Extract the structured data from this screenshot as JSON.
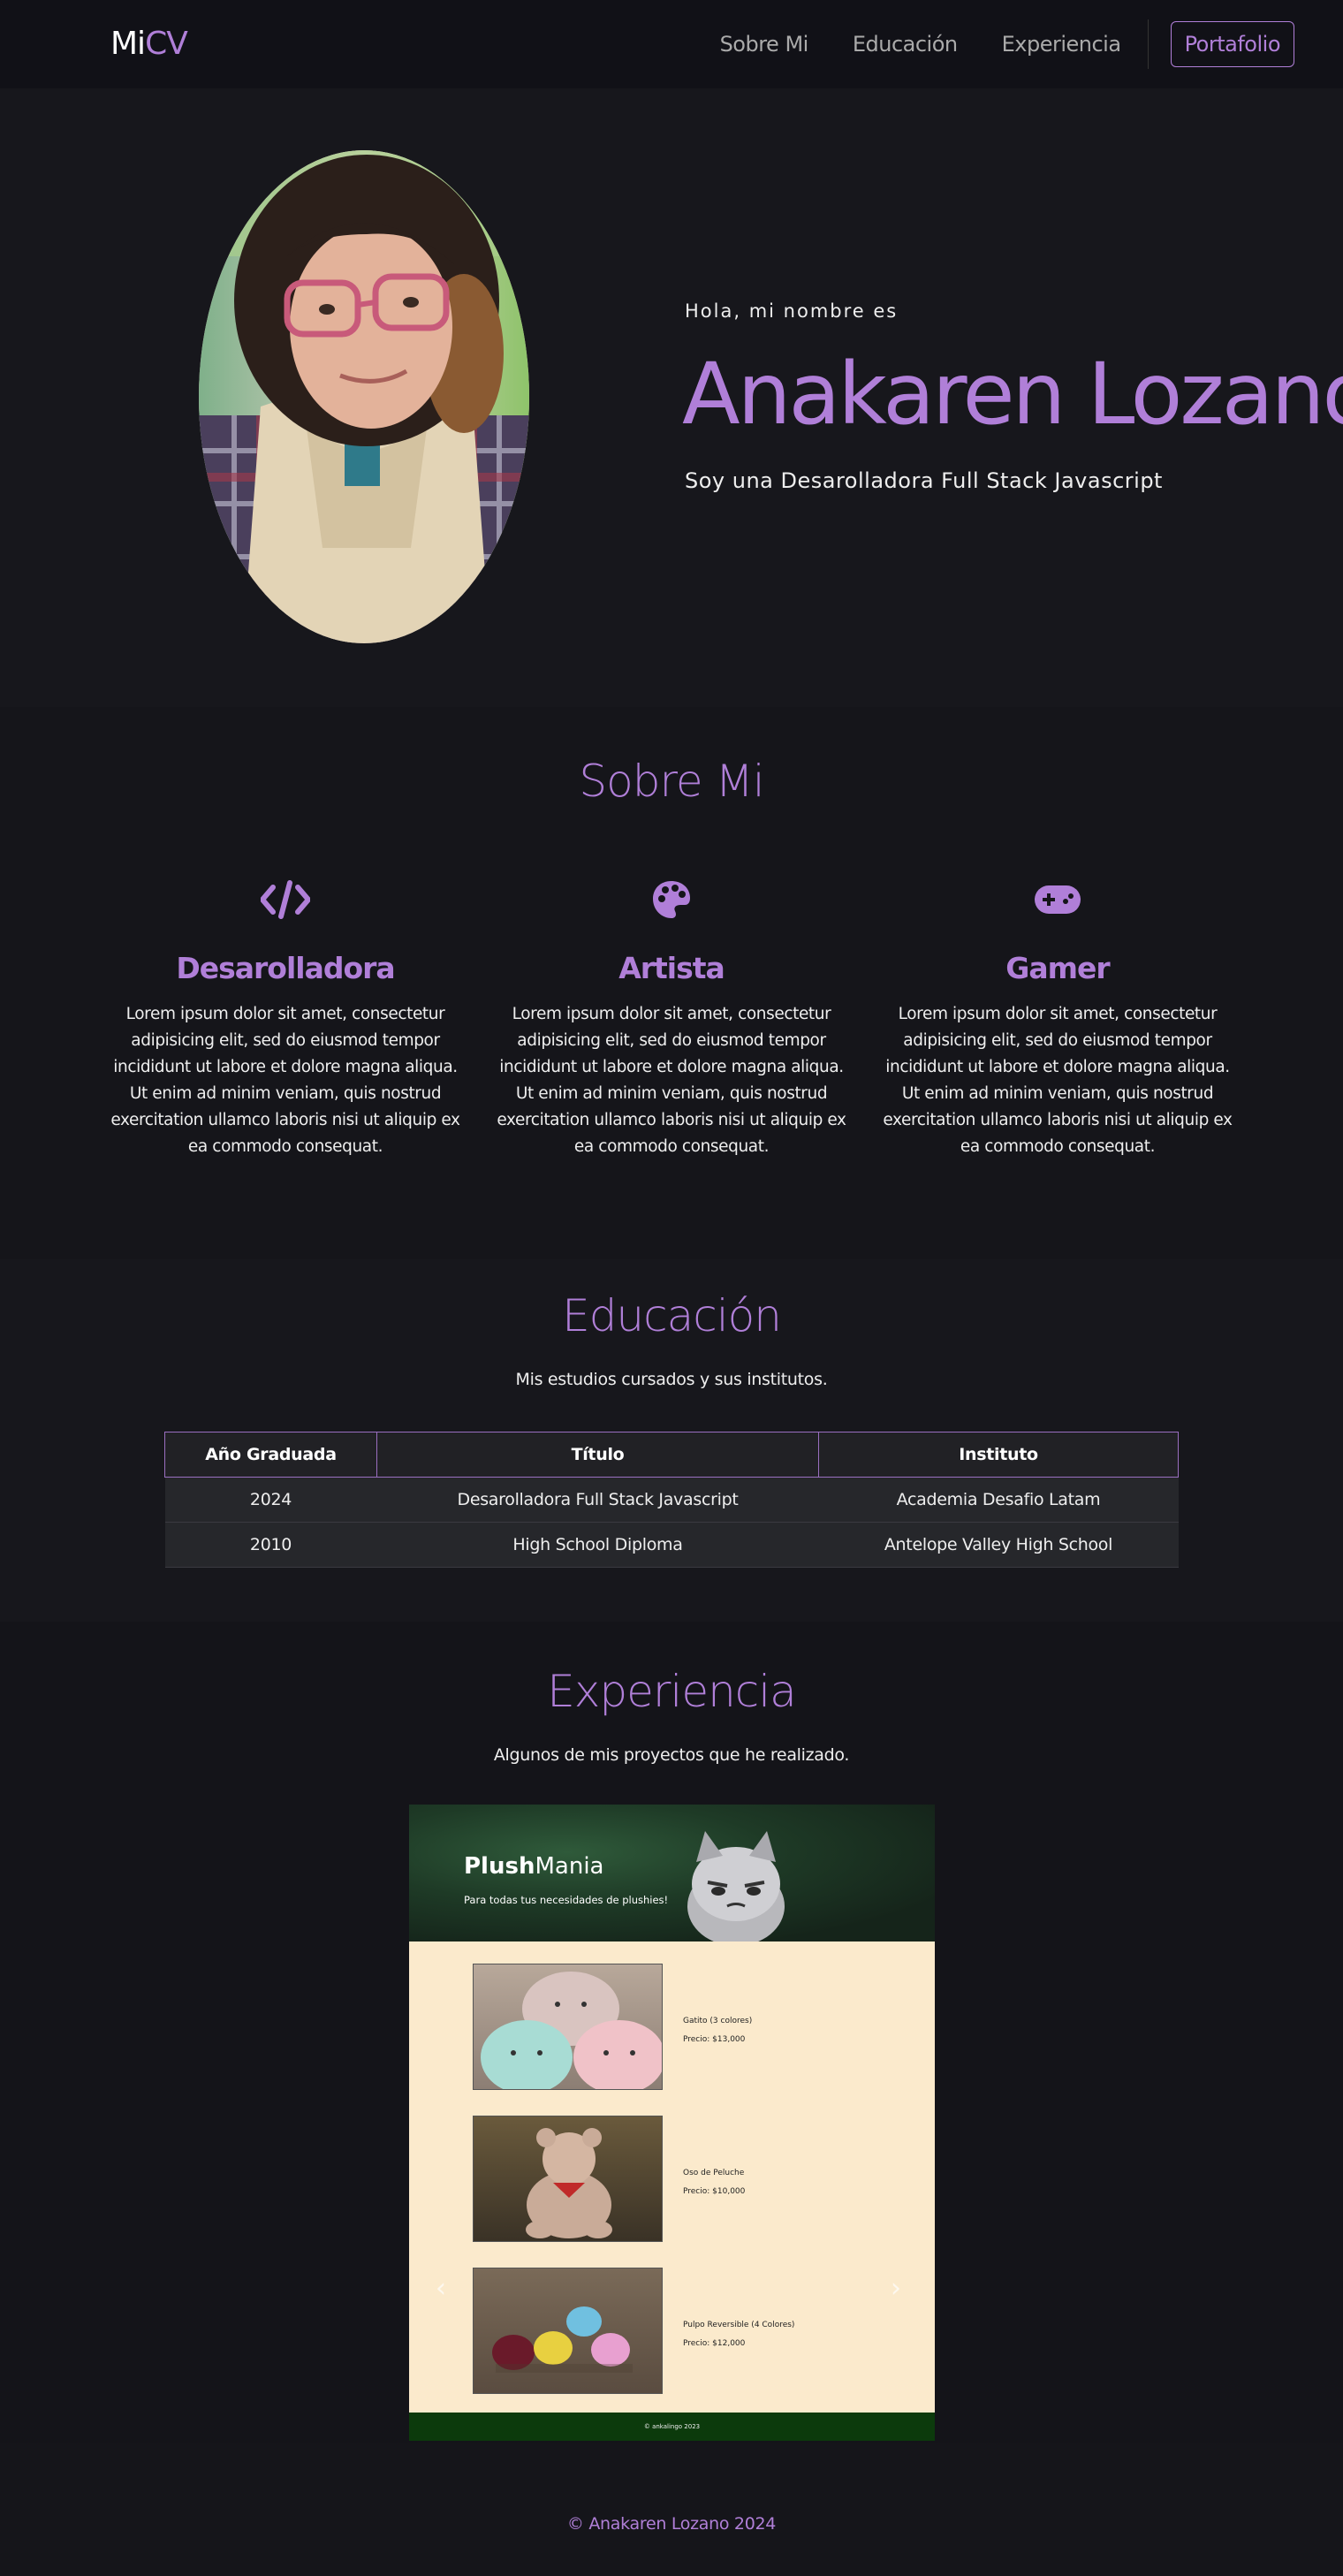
{
  "nav": {
    "logo_part1": "Mi",
    "logo_part2": "CV",
    "links": [
      "Sobre Mi",
      "Educación",
      "Experiencia"
    ],
    "button": "Portafolio"
  },
  "hero": {
    "greeting": "Hola, mi nombre es",
    "name": "Anakaren Lozano",
    "subtitle": "Soy una Desarolladora Full Stack Javascript"
  },
  "sobre": {
    "title": "Sobre Mi",
    "features": [
      {
        "icon": "code-icon",
        "title": "Desarolladora",
        "text": "Lorem ipsum dolor sit amet, consectetur adipisicing elit, sed do eiusmod tempor incididunt ut labore et dolore magna aliqua. Ut enim ad minim veniam, quis nostrud exercitation ullamco laboris nisi ut aliquip ex ea commodo consequat."
      },
      {
        "icon": "palette-icon",
        "title": "Artista",
        "text": "Lorem ipsum dolor sit amet, consectetur adipisicing elit, sed do eiusmod tempor incididunt ut labore et dolore magna aliqua. Ut enim ad minim veniam, quis nostrud exercitation ullamco laboris nisi ut aliquip ex ea commodo consequat."
      },
      {
        "icon": "gamepad-icon",
        "title": "Gamer",
        "text": "Lorem ipsum dolor sit amet, consectetur adipisicing elit, sed do eiusmod tempor incididunt ut labore et dolore magna aliqua. Ut enim ad minim veniam, quis nostrud exercitation ullamco laboris nisi ut aliquip ex ea commodo consequat."
      }
    ]
  },
  "educacion": {
    "title": "Educación",
    "subtitle": "Mis estudios cursados y sus institutos.",
    "headers": [
      "Año Graduada",
      "Título",
      "Instituto"
    ],
    "rows": [
      [
        "2024",
        "Desarolladora Full Stack Javascript",
        "Academia Desafio Latam"
      ],
      [
        "2010",
        "High School Diploma",
        "Antelope Valley High School"
      ]
    ]
  },
  "experiencia": {
    "title": "Experiencia",
    "subtitle": "Algunos de mis proyectos que he realizado.",
    "project": {
      "brand_bold": "Plush",
      "brand_rest": "Mania",
      "tagline": "Para todas tus necesidades de plushies!",
      "products": [
        {
          "name": "Gatito (3 colores)",
          "price": "Precio: $13,000"
        },
        {
          "name": "Oso de Peluche",
          "price": "Precio: $10,000"
        },
        {
          "name": "Pulpo Reversible (4 Colores)",
          "price": "Precio: $12,000"
        }
      ],
      "footer": "© ankalingo 2023"
    }
  },
  "footer": {
    "text": "© Anakaren Lozano 2024"
  },
  "colors": {
    "accent": "#b07fd8",
    "background": "#17171c",
    "nav_background": "#111117",
    "project_background": "#fbeacc",
    "project_footer": "#0c3a0c"
  }
}
